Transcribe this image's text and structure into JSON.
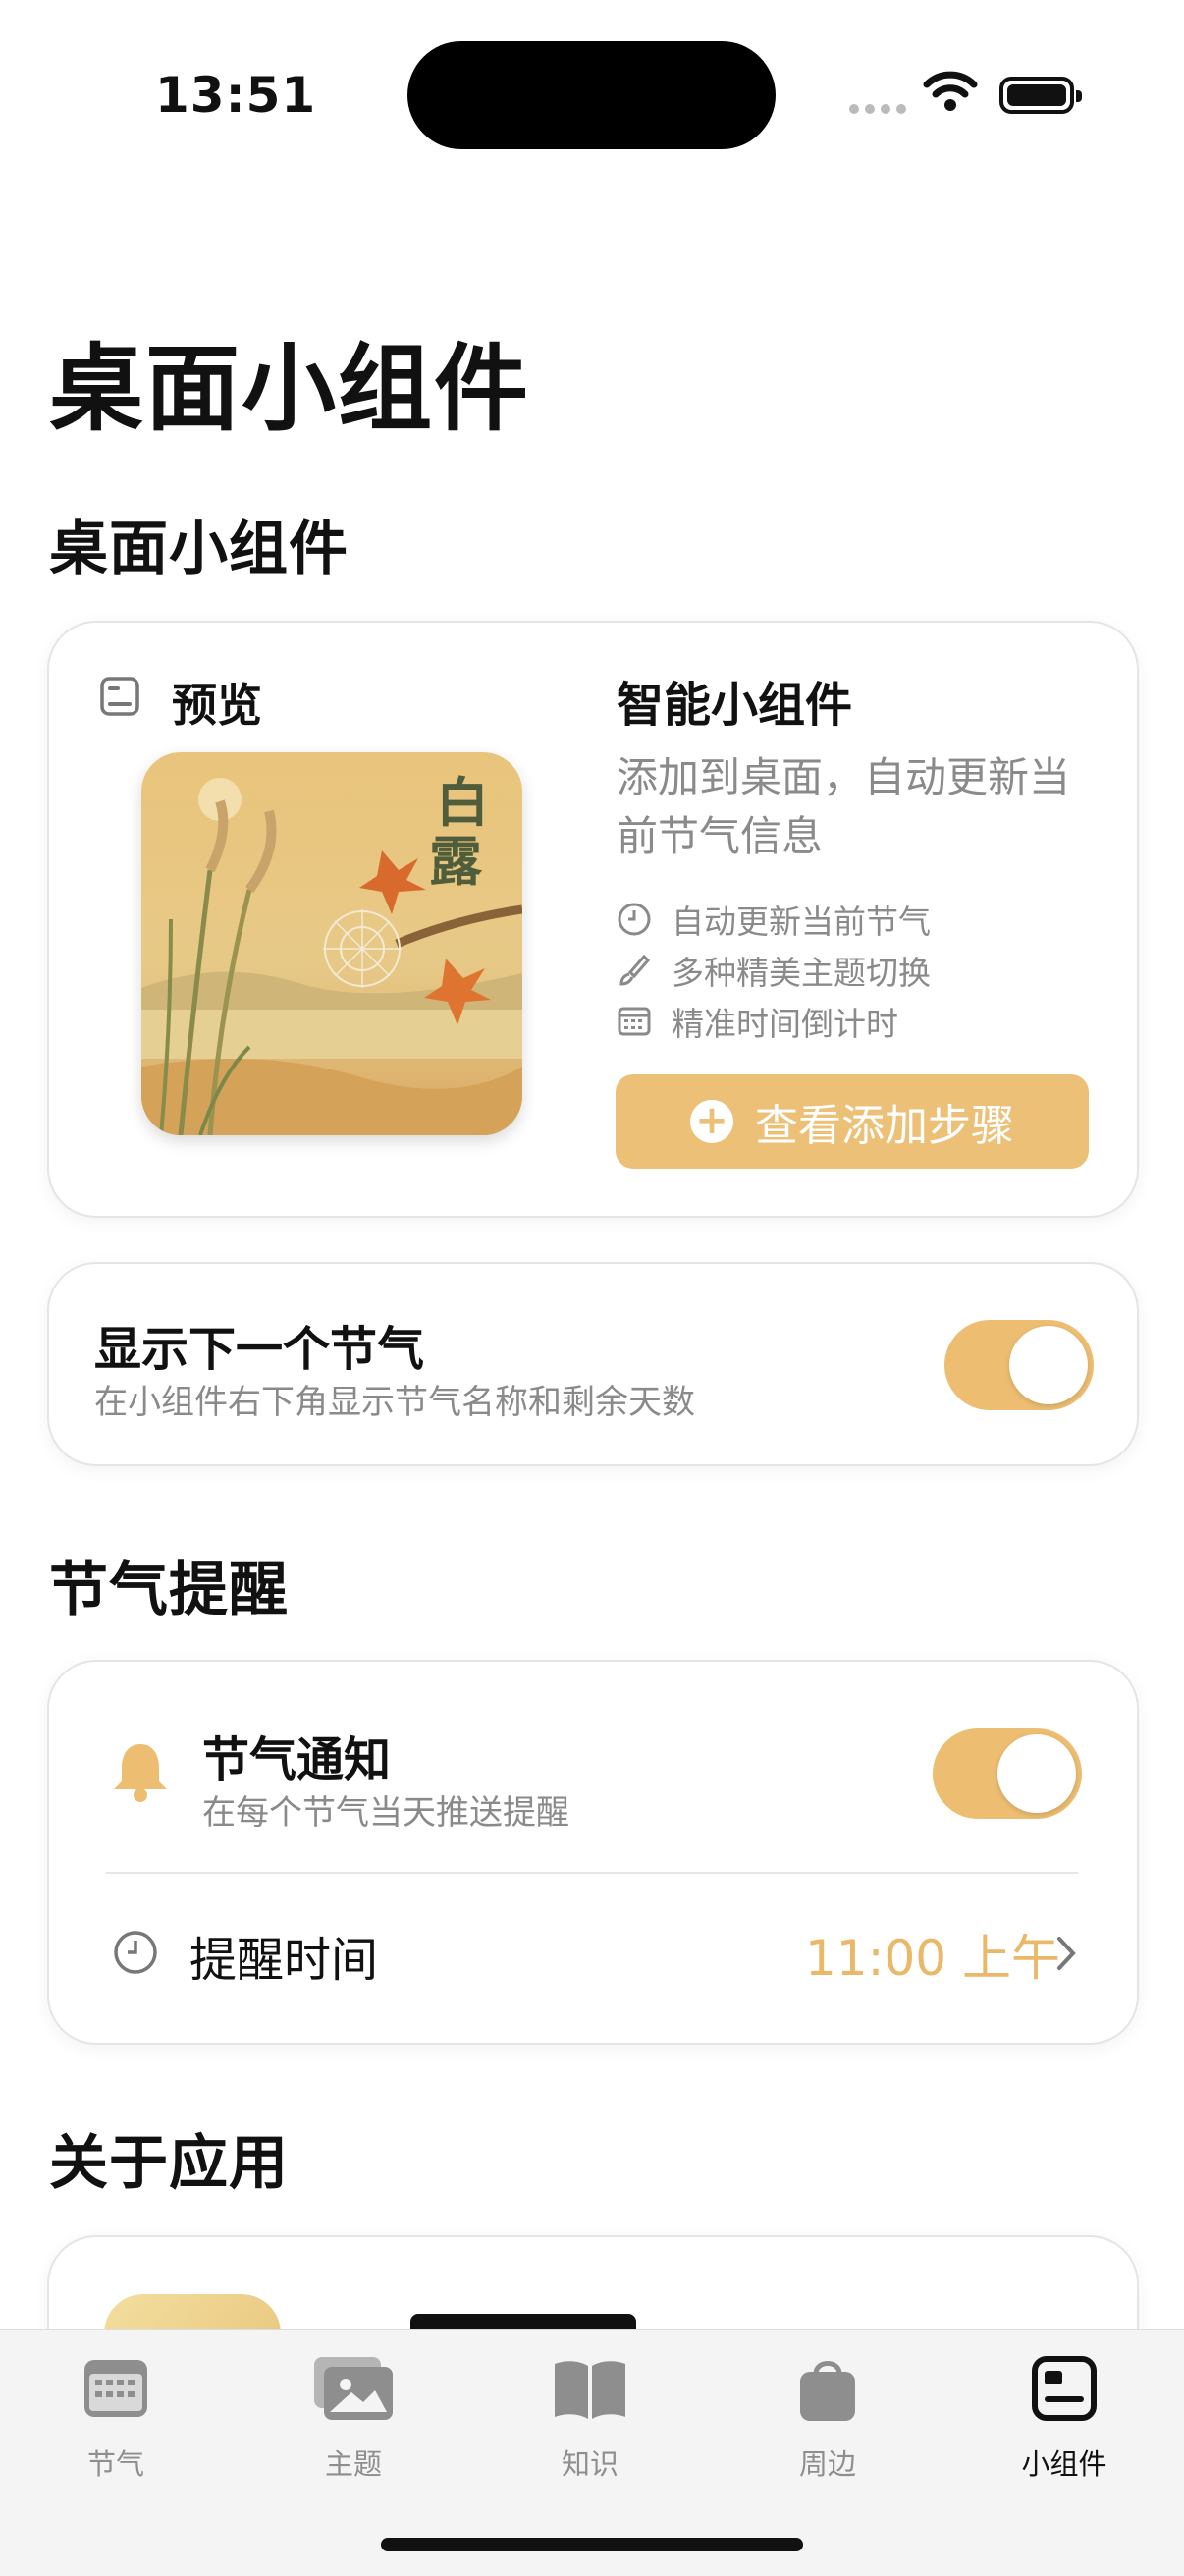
{
  "status_bar": {
    "time": "13:51"
  },
  "page_title": "桌面小组件",
  "sections": {
    "widget": "桌面小组件",
    "reminder": "节气提醒",
    "about": "关于应用"
  },
  "widget_card": {
    "preview_label": "预览",
    "preview_characters": "白露",
    "smart_title": "智能小组件",
    "description": "添加到桌面，自动更新当前节气信息",
    "features": [
      "自动更新当前节气",
      "多种精美主题切换",
      "精准时间倒计时"
    ],
    "button_label": "查看添加步骤"
  },
  "next_term": {
    "title": "显示下一个节气",
    "subtitle": "在小组件右下角显示节气名称和剩余天数",
    "enabled": true
  },
  "reminder": {
    "notify_title": "节气通知",
    "notify_subtitle": "在每个节气当天推送提醒",
    "notify_enabled": true,
    "time_label": "提醒时间",
    "time_value": "11:00 上午"
  },
  "about_card": {
    "app_name_partial": ""
  },
  "tabs": [
    {
      "label": "节气",
      "icon": "calendar-icon",
      "active": false
    },
    {
      "label": "主题",
      "icon": "photos-icon",
      "active": false
    },
    {
      "label": "知识",
      "icon": "book-icon",
      "active": false
    },
    {
      "label": "周边",
      "icon": "bag-icon",
      "active": false
    },
    {
      "label": "小组件",
      "icon": "widget-icon",
      "active": true
    }
  ],
  "colors": {
    "accent": "#EDBE72",
    "text": "#111111",
    "muted": "#8A8A8A"
  }
}
